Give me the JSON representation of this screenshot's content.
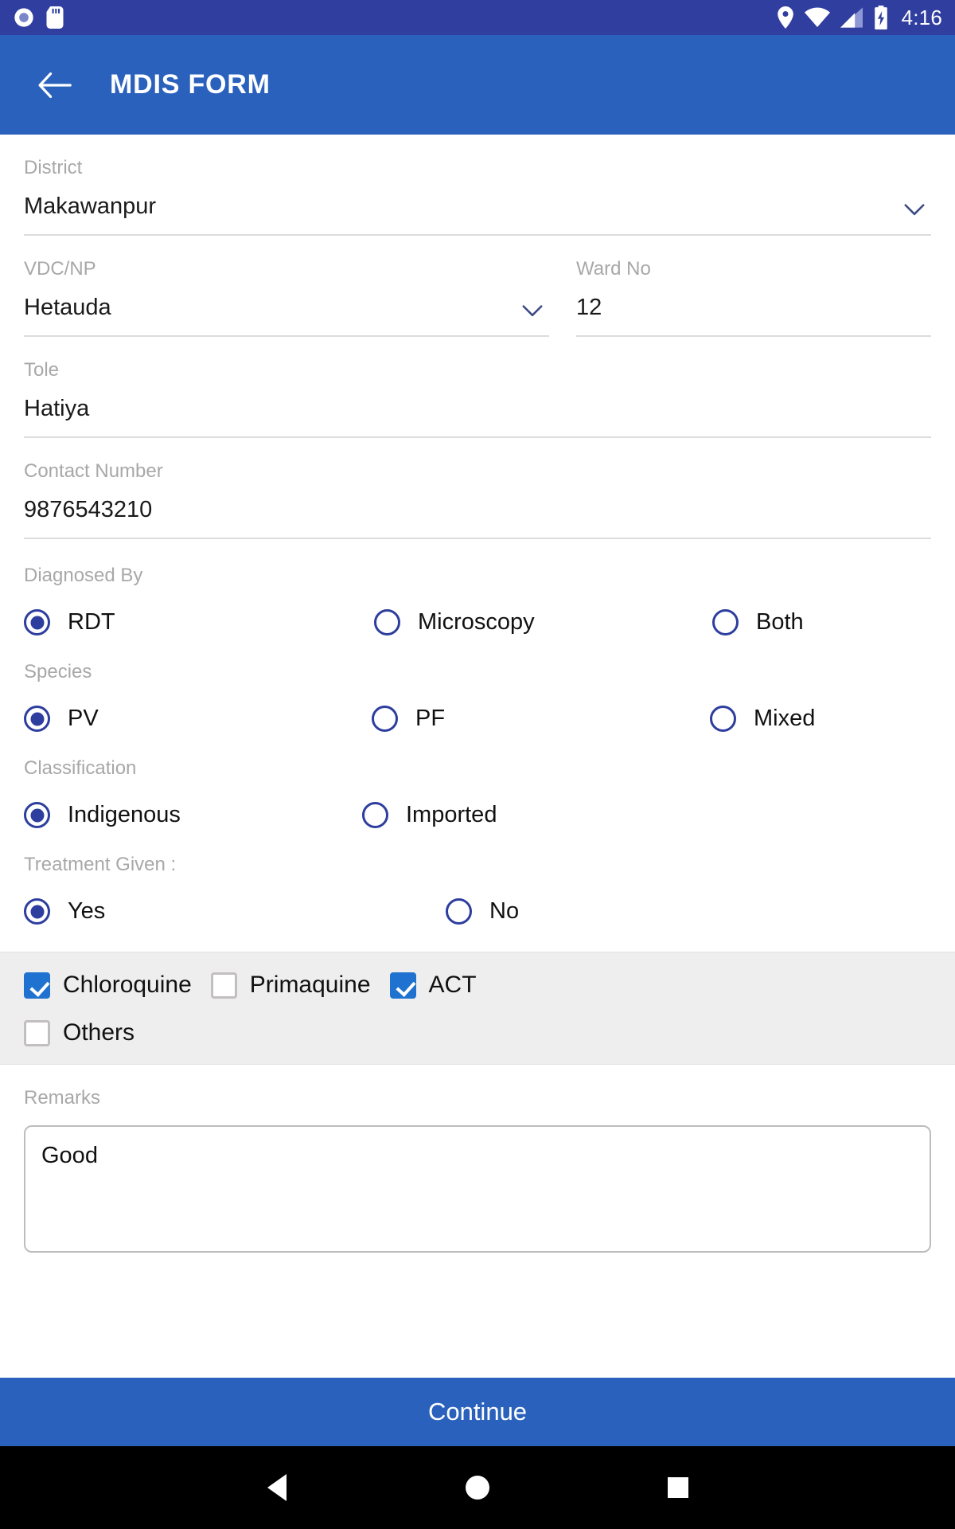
{
  "status_bar": {
    "time": "4:16",
    "left_icons": [
      "camera-icon",
      "sd-card-icon"
    ],
    "right_icons": [
      "location-pin-icon",
      "wifi-icon",
      "signal-bars-icon",
      "battery-charging-icon"
    ],
    "background_color": "#303f9f"
  },
  "app_bar": {
    "title": "MDIS FORM",
    "back_icon": "back-arrow-icon",
    "background_color": "#2a61bd"
  },
  "form": {
    "district": {
      "label": "District",
      "value": "Makawanpur",
      "has_dropdown": true
    },
    "vdc_np": {
      "label": "VDC/NP",
      "value": "Hetauda",
      "has_dropdown": true
    },
    "ward_no": {
      "label": "Ward No",
      "value": "12",
      "has_dropdown": false
    },
    "tole": {
      "label": "Tole",
      "value": "Hatiya",
      "has_dropdown": false
    },
    "contact_number": {
      "label": "Contact Number",
      "value": "9876543210",
      "has_dropdown": false
    },
    "diagnosed_by": {
      "label": "Diagnosed By",
      "options": [
        {
          "label": "RDT",
          "selected": true
        },
        {
          "label": "Microscopy",
          "selected": false
        },
        {
          "label": "Both",
          "selected": false
        }
      ]
    },
    "species": {
      "label": "Species",
      "options": [
        {
          "label": "PV",
          "selected": true
        },
        {
          "label": "PF",
          "selected": false
        },
        {
          "label": "Mixed",
          "selected": false
        }
      ]
    },
    "classification": {
      "label": "Classification",
      "options": [
        {
          "label": "Indigenous",
          "selected": true
        },
        {
          "label": "Imported",
          "selected": false
        }
      ]
    },
    "treatment_given": {
      "label": "Treatment Given :",
      "options": [
        {
          "label": "Yes",
          "selected": true
        },
        {
          "label": "No",
          "selected": false
        }
      ]
    },
    "medications": {
      "row1": [
        {
          "label": "Chloroquine",
          "checked": true
        },
        {
          "label": "Primaquine",
          "checked": false
        },
        {
          "label": "ACT",
          "checked": true
        }
      ],
      "row2": [
        {
          "label": "Others",
          "checked": false
        }
      ]
    },
    "remarks": {
      "label": "Remarks",
      "value": "Good"
    }
  },
  "continue_button": {
    "label": "Continue",
    "background_color": "#2a61bd"
  },
  "nav_bar": {
    "back_icon": "nav-back-icon",
    "home_icon": "nav-home-icon",
    "recents_icon": "nav-recents-icon"
  },
  "colors": {
    "status_bar": "#303f9f",
    "app_bar": "#2a61bd",
    "radio_accent": "#2d3e9e",
    "checkbox_accent": "#1f72d0",
    "label_gray": "#a8a8a8",
    "checkbox_section_bg": "#eeeeee"
  }
}
